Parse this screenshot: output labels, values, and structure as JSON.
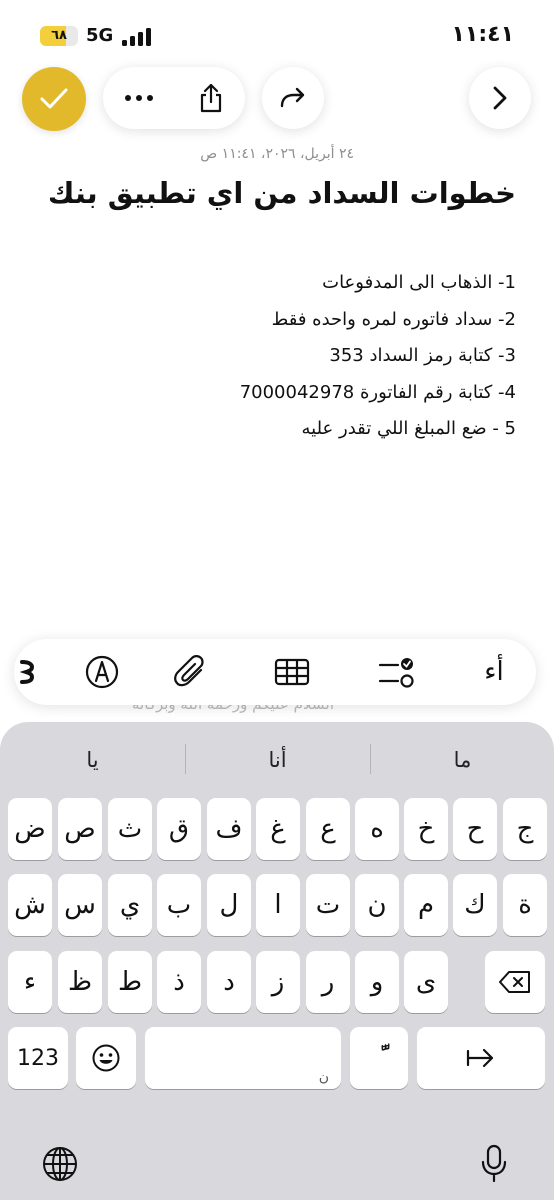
{
  "status_bar": {
    "time": "١١:٤١",
    "network": "5G",
    "battery_level": "٦٨",
    "battery_fraction": 0.68
  },
  "toolbar": {
    "done_icon": "checkmark-icon",
    "more_icon": "ellipsis-icon",
    "share_icon": "share-icon",
    "redo_icon": "redo-icon",
    "forward_icon": "chevron-right-icon",
    "accent_color": "#e3b92c"
  },
  "note": {
    "date": "٢٤ أبريل، ٢٠٢٦، ١١:٤١ ص",
    "title": "خطوات السداد من اي تطبيق بنك",
    "steps": [
      "1- الذهاب الى المدفوعات",
      "2- سداد فاتوره لمره واحده فقط",
      "3- كتابة رمز السداد 353",
      "4- كتابة  رقم الفاتورة 7000042978",
      "5 - ضع المبلغ اللي تقدر عليه"
    ],
    "ghost_text": "السلام عليكم ورحمة الله وبركاته"
  },
  "format_bar": {
    "text_style_label": "أء",
    "icons": [
      "checklist-icon",
      "table-icon",
      "attachment-icon",
      "markup-icon",
      "more-format-icon"
    ]
  },
  "keyboard": {
    "suggestions": [
      "يا",
      "أنا",
      "ما"
    ],
    "row1": [
      "ض",
      "ص",
      "ث",
      "ق",
      "ف",
      "غ",
      "ع",
      "ه",
      "خ",
      "ح",
      "ج"
    ],
    "row2": [
      "ش",
      "س",
      "ي",
      "ب",
      "ل",
      "ا",
      "ت",
      "ن",
      "م",
      "ك",
      "ة"
    ],
    "row3": [
      "ء",
      "ظ",
      "ط",
      "ذ",
      "د",
      "ز",
      "ر",
      "و",
      "ى"
    ],
    "numbers_label": "123",
    "space_hint": "ن",
    "tanween_key": "ًّ"
  }
}
